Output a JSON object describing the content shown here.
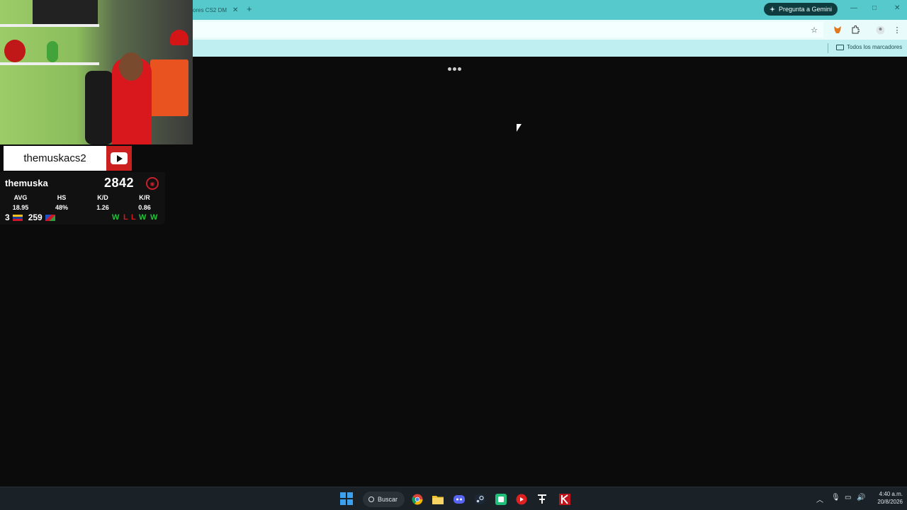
{
  "browser": {
    "tab_title": "ores CS2 DM",
    "tab_close": "✕",
    "new_tab": "+",
    "gemini_label": "Pregunta a Gemini",
    "bookmarks_all": "Todos los marcadores",
    "loading_dots": "•••"
  },
  "window_controls": {
    "minimize": "—",
    "maximize": "□",
    "close": "✕"
  },
  "toolbar_icons": [
    "star-icon",
    "metamask-icon",
    "extensions-icon",
    "profile-icon",
    "menu-icon"
  ],
  "overlay": {
    "channel_name": "themuskacs2",
    "player_name": "themuska",
    "elo": "2842",
    "stats": [
      {
        "label": "AVG",
        "value": "18.95"
      },
      {
        "label": "HS",
        "value": "48%"
      },
      {
        "label": "K/D",
        "value": "1.26"
      },
      {
        "label": "K/R",
        "value": "0.86"
      }
    ],
    "country_rank": "3",
    "region_rank": "259",
    "recent_results": [
      "W",
      "L",
      "L",
      "W",
      "W"
    ]
  },
  "taskbar": {
    "search_label": "Buscar",
    "apps": [
      "chrome-icon",
      "file-explorer-icon",
      "discord-icon",
      "steam-icon",
      "app-green-icon",
      "youtube-icon",
      "app-terminal-icon",
      "app-k-icon"
    ],
    "time": "4:40 a.m.",
    "date": "20/8/2026"
  },
  "colors": {
    "tabbar": "#56c9cd",
    "toolbar": "#e9fbfb",
    "bookmarks_bar": "#bfeff0",
    "content_bg": "#0b0b0b",
    "win_color": "#22c43a",
    "loss_color": "#d41a1a",
    "youtube_red": "#cc1f1f"
  }
}
